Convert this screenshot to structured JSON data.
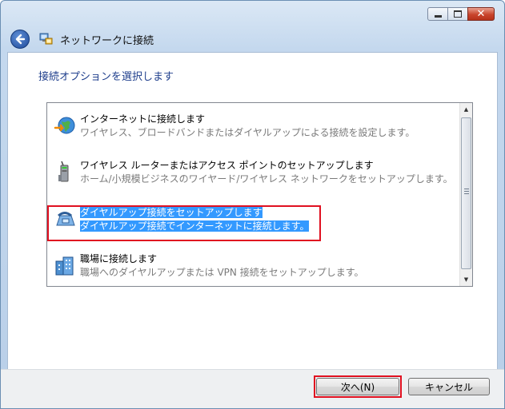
{
  "window": {
    "title": "ネットワークに接続",
    "caption": {
      "minimize_icon": "minimize-icon",
      "maximize_icon": "maximize-icon",
      "close_glyph": "✕"
    }
  },
  "main": {
    "instruction": "接続オプションを選択します",
    "options": [
      {
        "icon": "internet-globe-icon",
        "title": "インターネットに接続します",
        "description": "ワイヤレス、ブロードバンドまたはダイヤルアップによる接続を設定します。",
        "selected": false
      },
      {
        "icon": "wireless-router-icon",
        "title": "ワイヤレス ルーターまたはアクセス ポイントのセットアップします",
        "description": "ホーム/小規模ビジネスのワイヤード/ワイヤレス ネットワークをセットアップします。",
        "selected": false
      },
      {
        "icon": "dialup-phone-icon",
        "title": "ダイヤルアップ接続をセットアップします",
        "description": "ダイヤルアップ接続でインターネットに接続します。",
        "selected": true
      },
      {
        "icon": "workplace-building-icon",
        "title": "職場に接続します",
        "description": "職場へのダイヤルアップまたは VPN 接続をセットアップします。",
        "selected": false
      }
    ]
  },
  "footer": {
    "next_label": "次へ(N)",
    "cancel_label": "キャンセル"
  }
}
